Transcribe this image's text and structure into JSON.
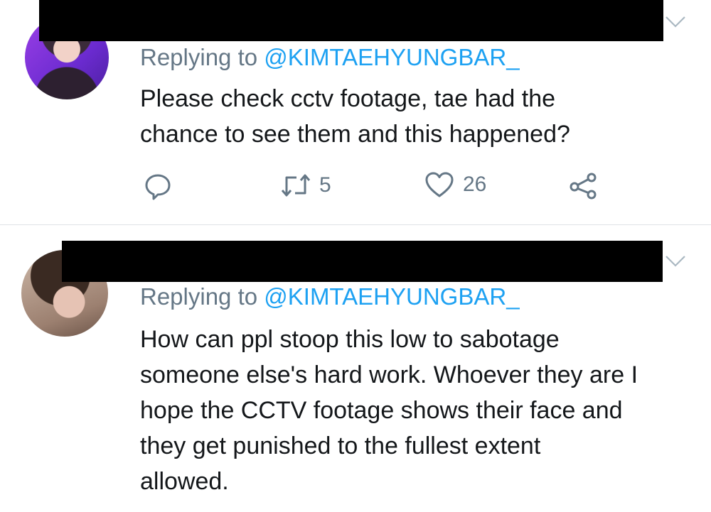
{
  "tweets": [
    {
      "replying_prefix": "Replying to ",
      "replying_handle": "@KIMTAEHYUNGBAR_",
      "text_lines": [
        "Please check cctv footage, tae had the",
        "chance to see them and this happened?"
      ],
      "retweet_count": "5",
      "like_count": "26"
    },
    {
      "replying_prefix": "Replying to ",
      "replying_handle": "@KIMTAEHYUNGBAR_",
      "text_lines": [
        "How can ppl stoop this low to sabotage",
        "someone else's hard work. Whoever they are I",
        "hope the CCTV footage shows their face and",
        "they get punished to the fullest extent",
        "allowed."
      ]
    }
  ],
  "icons": {
    "reply": "reply-bubble-icon",
    "retweet": "retweet-icon",
    "like": "heart-icon",
    "share": "share-icon",
    "menu": "chevron-down-icon"
  },
  "colors": {
    "handle": "#1da1f2",
    "muted": "#657786",
    "text": "#14171a",
    "redaction": "#000000"
  }
}
